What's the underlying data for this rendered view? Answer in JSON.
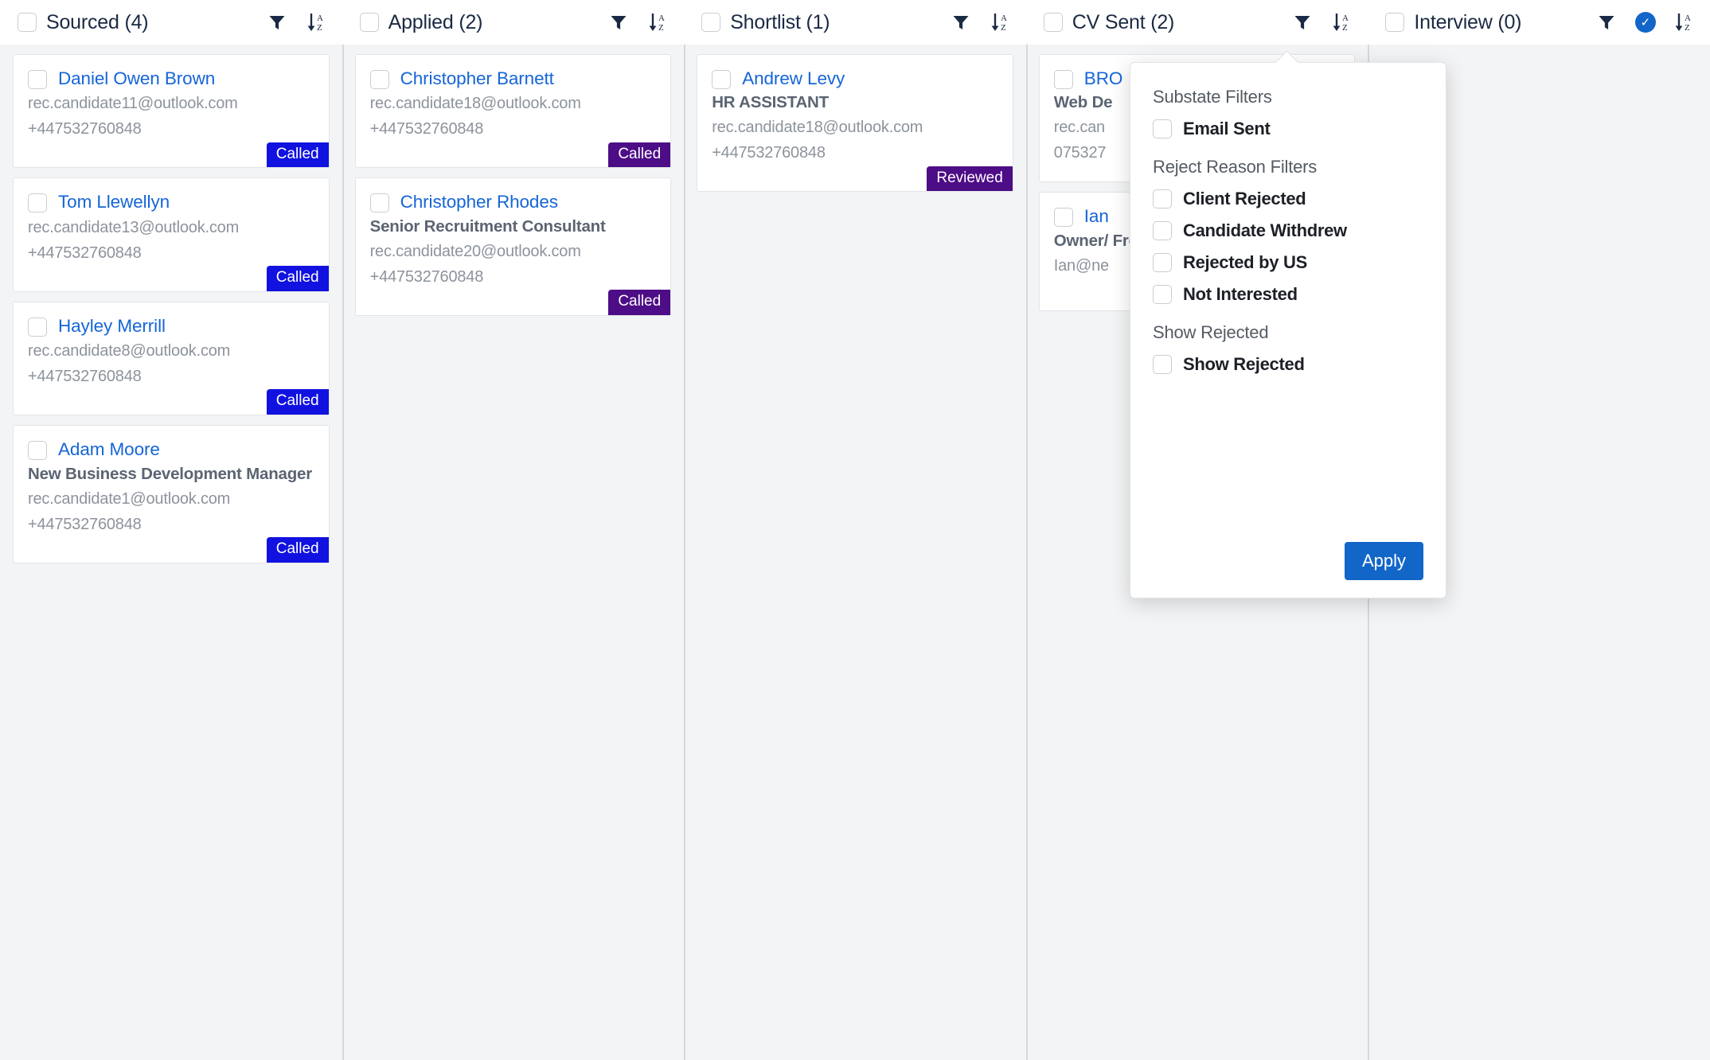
{
  "colors": {
    "called_blue": "#1111e0",
    "called_purple": "#4d0d86",
    "reviewed_purple": "#4d0d86",
    "accent_blue": "#1266c8",
    "link_blue": "#1565d8",
    "header_text": "#1b2a44"
  },
  "columns": [
    {
      "title": "Sourced (4)",
      "filter_active": false,
      "cards": [
        {
          "name": "Daniel Owen Brown",
          "job_title": "",
          "email": "rec.candidate11@outlook.com",
          "phone": "+447532760848",
          "badge": "Called",
          "badge_color": "#1111e0"
        },
        {
          "name": "Tom Llewellyn",
          "job_title": "",
          "email": "rec.candidate13@outlook.com",
          "phone": "+447532760848",
          "badge": "Called",
          "badge_color": "#1111e0"
        },
        {
          "name": "Hayley Merrill",
          "job_title": "",
          "email": "rec.candidate8@outlook.com",
          "phone": "+447532760848",
          "badge": "Called",
          "badge_color": "#1111e0"
        },
        {
          "name": "Adam Moore",
          "job_title": "New Business Development Manager",
          "email": "rec.candidate1@outlook.com",
          "phone": "+447532760848",
          "badge": "Called",
          "badge_color": "#1111e0"
        }
      ]
    },
    {
      "title": "Applied (2)",
      "filter_active": false,
      "cards": [
        {
          "name": "Christopher Barnett",
          "job_title": "",
          "email": "rec.candidate18@outlook.com",
          "phone": "+447532760848",
          "badge": "Called",
          "badge_color": "#4d0d86"
        },
        {
          "name": "Christopher Rhodes",
          "job_title": "Senior Recruitment Consultant",
          "email": "rec.candidate20@outlook.com",
          "phone": "+447532760848",
          "badge": "Called",
          "badge_color": "#4d0d86"
        }
      ]
    },
    {
      "title": "Shortlist (1)",
      "filter_active": false,
      "cards": [
        {
          "name": "Andrew Levy",
          "job_title": "HR ASSISTANT",
          "email": "rec.candidate18@outlook.com",
          "phone": "+447532760848",
          "badge": "Reviewed",
          "badge_color": "#4d0d86"
        }
      ]
    },
    {
      "title": "CV Sent (2)",
      "filter_active": false,
      "cards": [
        {
          "name": "BRO",
          "job_title": "Web De",
          "email": "rec.can",
          "phone": "075327",
          "badge": "",
          "badge_color": ""
        },
        {
          "name": "Ian",
          "job_title": "Owner/ Freelan",
          "email": "Ian@ne",
          "phone": "",
          "badge": "",
          "badge_color": ""
        }
      ]
    },
    {
      "title": "Interview (0)",
      "filter_active": true,
      "cards": []
    }
  ],
  "dropdown": {
    "sections": [
      {
        "title": "Substate Filters",
        "options": [
          {
            "label": "Email Sent",
            "checked": false
          }
        ]
      },
      {
        "title": "Reject Reason Filters",
        "options": [
          {
            "label": "Client Rejected",
            "checked": false
          },
          {
            "label": "Candidate Withdrew",
            "checked": false
          },
          {
            "label": "Rejected by US",
            "checked": false
          },
          {
            "label": "Not Interested",
            "checked": false
          }
        ]
      },
      {
        "title": "Show Rejected",
        "options": [
          {
            "label": "Show Rejected",
            "checked": false
          }
        ]
      }
    ],
    "apply_label": "Apply"
  }
}
